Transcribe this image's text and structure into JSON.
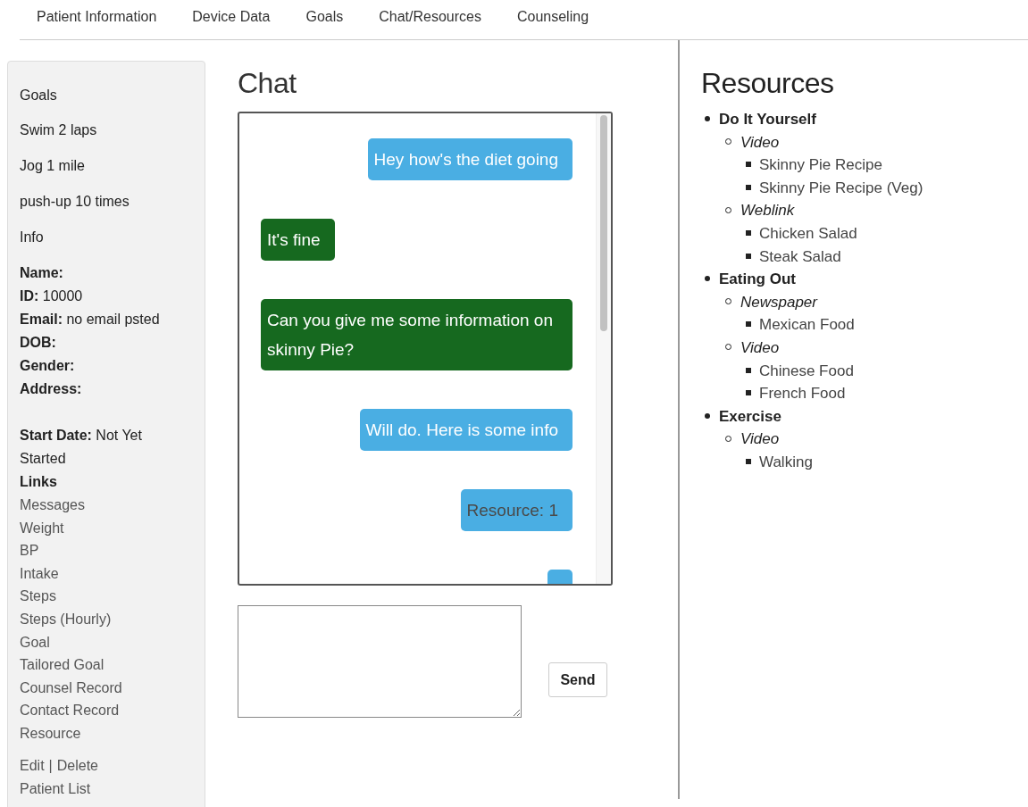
{
  "nav": {
    "tabs": [
      {
        "label": "Patient Information"
      },
      {
        "label": "Device Data"
      },
      {
        "label": "Goals"
      },
      {
        "label": "Chat/Resources"
      },
      {
        "label": "Counseling"
      }
    ]
  },
  "sidebar": {
    "goals_heading": "Goals",
    "goals": [
      "Swim 2 laps",
      "Jog 1 mile",
      "push-up 10 times"
    ],
    "info_heading": "Info",
    "fields": [
      {
        "label": "Name:"
      },
      {
        "label": "ID:",
        "value": "10000"
      },
      {
        "label": "Email:",
        "value": "no email psted"
      },
      {
        "label": "DOB:"
      },
      {
        "label": "Gender:"
      },
      {
        "label": "Address:"
      }
    ],
    "start_date": {
      "label": "Start Date:",
      "value": "Not Yet Started"
    },
    "links_heading": "Links",
    "links": [
      "Messages",
      "Weight",
      "BP",
      "Intake",
      "Steps",
      "Steps (Hourly)",
      "Goal",
      "Tailored Goal",
      "Counsel Record",
      "Contact Record",
      "Resource"
    ],
    "actions": [
      "Edit",
      "Delete"
    ],
    "action_separator": "|",
    "patient_list": "Patient List"
  },
  "chat": {
    "title": "Chat",
    "messages": [
      {
        "kind": "sent",
        "text": "Hey how's the diet going"
      },
      {
        "kind": "received",
        "text": "It's fine"
      },
      {
        "kind": "received",
        "text": "Can you give me some information on skinny Pie?"
      },
      {
        "kind": "sent",
        "text": "Will do. Here is some info"
      },
      {
        "kind": "resource",
        "text": "Resource: 1"
      },
      {
        "kind": "sent"
      }
    ],
    "send_button": "Send"
  },
  "resources": {
    "title": "Resources",
    "items": [
      {
        "label": "Do It Yourself",
        "children": [
          {
            "label": "Video",
            "children": [
              {
                "label": "Skinny Pie Recipe"
              },
              {
                "label": "Skinny Pie Recipe (Veg)"
              }
            ]
          },
          {
            "label": "Weblink",
            "children": [
              {
                "label": "Chicken Salad"
              },
              {
                "label": "Steak Salad"
              }
            ]
          }
        ]
      },
      {
        "label": "Eating Out",
        "children": [
          {
            "label": "Newspaper",
            "children": [
              {
                "label": "Mexican Food"
              }
            ]
          },
          {
            "label": "Video",
            "children": [
              {
                "label": "Chinese Food"
              },
              {
                "label": "French Food"
              }
            ]
          }
        ]
      },
      {
        "label": "Exercise",
        "children": [
          {
            "label": "Video",
            "children": [
              {
                "label": "Walking"
              }
            ]
          }
        ]
      }
    ]
  }
}
